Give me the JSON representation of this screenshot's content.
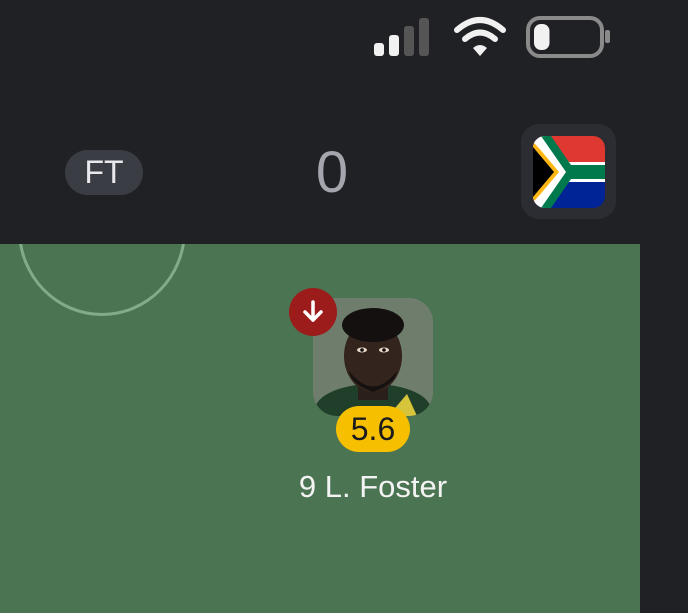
{
  "status_bar": {
    "signal_icon": "cellular-signal-icon",
    "wifi_icon": "wifi-icon",
    "battery_icon": "battery-icon",
    "battery_level": 0.25
  },
  "match": {
    "status": "FT",
    "score": "0",
    "team_flag": "south-africa-flag-icon"
  },
  "player": {
    "number": "9",
    "name": "L. Foster",
    "label": "9 L. Foster",
    "rating": "5.6",
    "substitution_icon": "arrow-down-icon"
  },
  "colors": {
    "background": "#202125",
    "pitch": "#4b7452",
    "rating_badge": "#f6c000",
    "substitution_badge": "#9b1c1a"
  }
}
